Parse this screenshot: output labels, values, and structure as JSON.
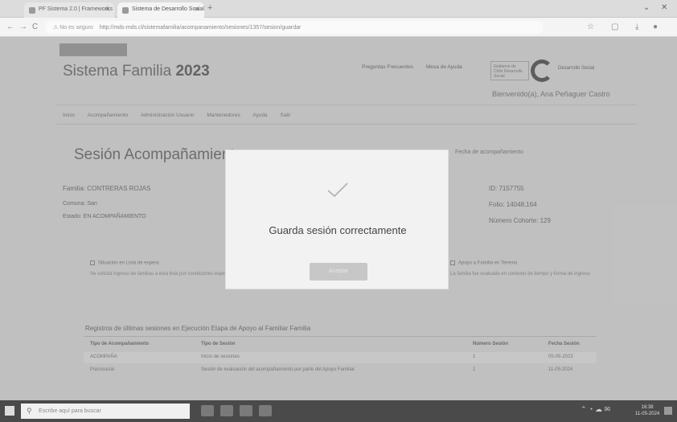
{
  "browser": {
    "tabs": [
      {
        "label": "PF Sistema 2.0 | Frameworks"
      },
      {
        "label": "Sistema de Desarrollo Social"
      }
    ],
    "new_tab_symbol": "+",
    "window_controls": {
      "minimize": "⌄",
      "close": "✕"
    },
    "nav": {
      "back": "←",
      "forward": "→",
      "reload": "C"
    },
    "url": {
      "security": "⚠ No es seguro",
      "text": "http://mds-mds.cl/sistemafamilia/acompanamiento/sesiones/1357/sesion/guardar"
    },
    "toolbar_icons": [
      "star-icon",
      "extensions-icon",
      "download-icon",
      "profile-icon"
    ]
  },
  "header": {
    "app_title": "Sistema Familia",
    "app_year": "2023",
    "links": [
      "Preguntas Frecuentes",
      "Mesa de Ayuda"
    ],
    "gov_badge": "Gobierno de Chile Desarrollo Social",
    "gov_name": "Desarrollo Social",
    "welcome": "Bienvenido(a), Ana Peñaguer Castro"
  },
  "nav": {
    "items": [
      "Inicio",
      "Acompañamiento",
      "Administración Usuario",
      "Mantenedores",
      "Ayuda",
      "Salir"
    ]
  },
  "session": {
    "title": "Sesión Acompañamiento",
    "right_note": "Fecha de acompañamiento",
    "familia": "Familia: CONTRERAS ROJAS",
    "comuna": "Comuna: San",
    "estado": "Estado: EN ACOMPAÑAMIENTO",
    "id": "ID: 7157755",
    "folio": "Folio: 14048,164",
    "cohorte": "Número Cohorte: 129",
    "check_left": "Situación en Lista de espera",
    "line_left": "Se solicita ingreso de familias a esta lista por condiciones especiales",
    "check_right": "Apoyo a Familia en Terreno",
    "line_right": "La familia fue evaluada en contexto de tiempo y forma de ingreso"
  },
  "registro": {
    "title": "Registros de últimas sesiones en Ejecución Etapa de Apoyo al Familiar Familia",
    "columns": [
      "Tipo de Acompañamiento",
      "Tipo de Sesión",
      "Número Sesión",
      "Fecha Sesión"
    ],
    "rows": [
      [
        "ACOMPAÑA",
        "Inicio de sesiones",
        "1",
        "05-05-2023"
      ],
      [
        "Psicosocial",
        "Sesión de evaluación del acompañamiento por parte del Apoyo Familiar",
        "1",
        "11-05-2024"
      ]
    ]
  },
  "modal": {
    "icon": "checkmark-icon",
    "message": "Guarda sesión correctamente",
    "button_label": "Aceptar"
  },
  "taskbar": {
    "search_placeholder": "Escribe aquí para buscar",
    "clock_time": "16:38",
    "clock_date": "11-05-2024"
  }
}
